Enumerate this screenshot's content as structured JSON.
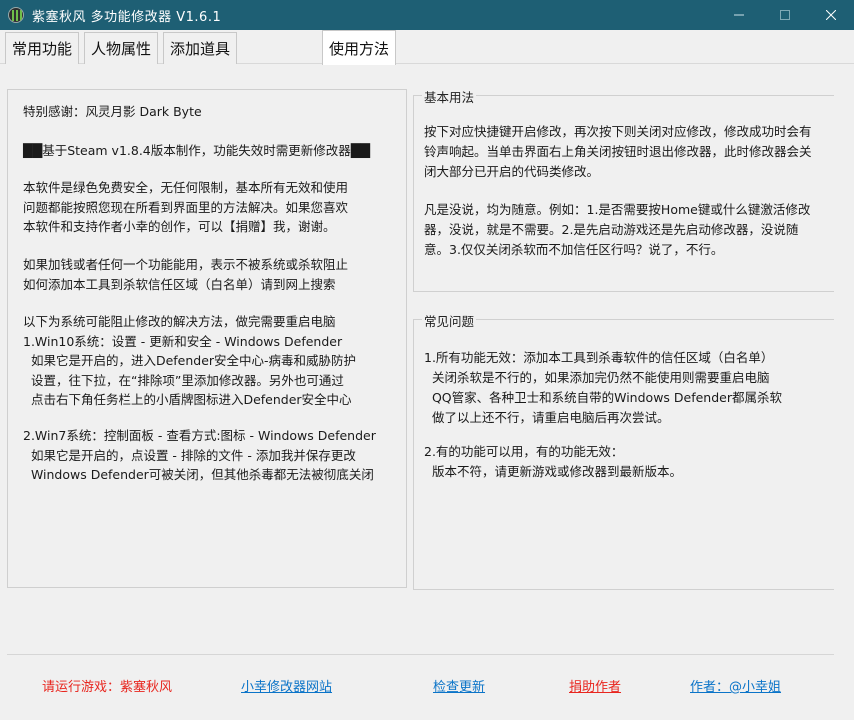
{
  "window": {
    "title": "紫塞秋风 多功能修改器  V1.6.1"
  },
  "tabs": [
    {
      "label": "常用功能"
    },
    {
      "label": "人物属性"
    },
    {
      "label": "添加道具"
    },
    {
      "label": "使用方法"
    }
  ],
  "left_panel": {
    "thanks": "特别感谢：风灵月影 Dark Byte",
    "version_note": "██基于Steam v1.8.4版本制作，功能失效时需更新修改器██",
    "para1": "本软件是绿色免费安全，无任何限制，基本所有无效和使用\n问题都能按照您现在所看到界面里的方法解决。如果您喜欢\n本软件和支持作者小幸的创作，可以【捐赠】我，谢谢。",
    "para2": "如果加钱或者任何一个功能能用，表示不被系统或杀软阻止\n如何添加本工具到杀软信任区域（白名单）请到网上搜索",
    "para3": "以下为系统可能阻止修改的解决方法，做完需要重启电脑\n1.Win10系统：设置 - 更新和安全 - Windows Defender\n  如果它是开启的，进入Defender安全中心-病毒和威胁防护\n  设置，往下拉，在“排除项”里添加修改器。另外也可通过\n  点击右下角任务栏上的小盾牌图标进入Defender安全中心",
    "para4": "2.Win7系统：控制面板 - 查看方式:图标 - Windows Defender\n  如果它是开启的，点设置 - 排除的文件 - 添加我并保存更改\n  Windows Defender可被关闭，但其他杀毒都无法被彻底关闭"
  },
  "basic_usage": {
    "title": "基本用法",
    "para1": "按下对应快捷键开启修改，再次按下则关闭对应修改，修改成功时会有\n铃声响起。当单击界面右上角关闭按钮时退出修改器，此时修改器会关\n闭大部分已开启的代码类修改。",
    "para2": "凡是没说，均为随意。例如：1.是否需要按Home键或什么键激活修改\n器，没说，就是不需要。2.是先启动游戏还是先启动修改器，没说随\n意。3.仅仅关闭杀软而不加信任区行吗？说了，不行。"
  },
  "faq": {
    "title": "常见问题",
    "para1": "1.所有功能无效：添加本工具到杀毒软件的信任区域（白名单）\n  关闭杀软是不行的，如果添加完仍然不能使用则需要重启电脑\n  QQ管家、各种卫士和系统自带的Windows Defender都属杀软\n  做了以上还不行，请重启电脑后再次尝试。",
    "para2": "2.有的功能可以用，有的功能无效：\n  版本不符，请更新游戏或修改器到最新版本。"
  },
  "footer": {
    "game_status": "请运行游戏：紫塞秋风",
    "website": "小幸修改器网站",
    "check_update": "检查更新",
    "donate": "捐助作者",
    "author": "作者：@小幸姐"
  },
  "colors": {
    "titlebar": "#1e5f74",
    "link_blue": "#0b74c8",
    "link_red": "#e8261f"
  }
}
